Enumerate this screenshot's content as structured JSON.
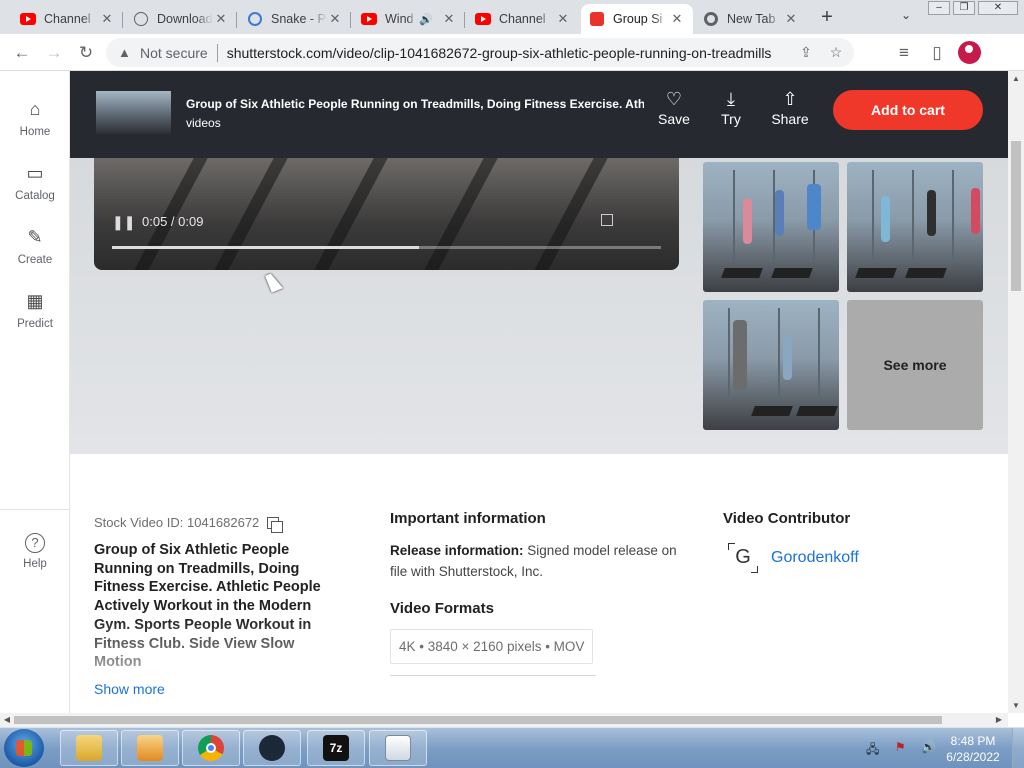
{
  "tabs": [
    {
      "title": "Channel",
      "icon": "youtube-icon"
    },
    {
      "title": "Download",
      "icon": "globe-icon"
    },
    {
      "title": "Snake - P",
      "icon": "snake-icon"
    },
    {
      "title": "Wind",
      "icon": "youtube-icon",
      "audio": "🔊"
    },
    {
      "title": "Channel",
      "icon": "youtube-icon"
    },
    {
      "title": "Group Si",
      "icon": "shutterstock-icon",
      "active": true
    },
    {
      "title": "New Tab",
      "icon": "chrome-icon"
    }
  ],
  "tab_close": "✕",
  "new_tab": "+",
  "tab_search": "⌄",
  "window_controls": {
    "minimize": "–",
    "maximize": "❐",
    "close": "✕"
  },
  "nav": {
    "back": "←",
    "forward": "→",
    "reload": "↻"
  },
  "address": {
    "security_label": "Not secure",
    "warning_icon": "▲",
    "url": "shutterstock.com/video/clip-1041682672-group-six-athletic-people-running-on-treadmills",
    "share_icon": "⇪",
    "bookmark_icon": "☆"
  },
  "toolbar_icons": {
    "media": "≡",
    "sidepanel": "▯"
  },
  "rail": [
    {
      "label": "Home",
      "icon": "⌂"
    },
    {
      "label": "Catalog",
      "icon": "▭"
    },
    {
      "label": "Create",
      "icon": "✎"
    },
    {
      "label": "Predict",
      "icon": "▦"
    }
  ],
  "help": {
    "label": "Help",
    "icon": "?"
  },
  "sticky": {
    "title": "Group of Six Athletic People Running on Treadmills, Doing Fitness Exercise. Athletic People Actively Workout",
    "subtitle": "videos",
    "save": "Save",
    "try": "Try",
    "share": "Share",
    "save_icon": "♡",
    "try_icon": "⤓",
    "share_icon": "⇧",
    "cart": "Add to cart"
  },
  "player": {
    "time": "0:05 / 0:09",
    "progress": 0.56,
    "pause_icon": "❚❚"
  },
  "see_more": "See more",
  "details": {
    "stock_id": "Stock Video ID: 1041682672",
    "title": "Group of Six Athletic People Running on Treadmills, Doing Fitness Exercise. Athletic People Actively Workout in the Modern Gym. Sports People Workout in Fitness Club. Side View Slow Motion",
    "show_more": "Show more",
    "important_heading": "Important information",
    "release_label": "Release information:",
    "release_text": "Signed model release on file with Shutterstock, Inc.",
    "formats_heading": "Video Formats",
    "format": "4K • 3840 × 2160 pixels • MOV",
    "contributor_heading": "Video Contributor",
    "contributor_logo": "G",
    "contributor": "Gorodenkoff"
  },
  "scroll_arrows": {
    "up": "▲",
    "down": "▼",
    "left": "◀",
    "right": "▶"
  },
  "taskbar": {
    "time": "8:48 PM",
    "date": "6/28/2022",
    "app_7zip": "7z",
    "tray": [
      "🖧",
      "⚑",
      "🔊"
    ]
  }
}
